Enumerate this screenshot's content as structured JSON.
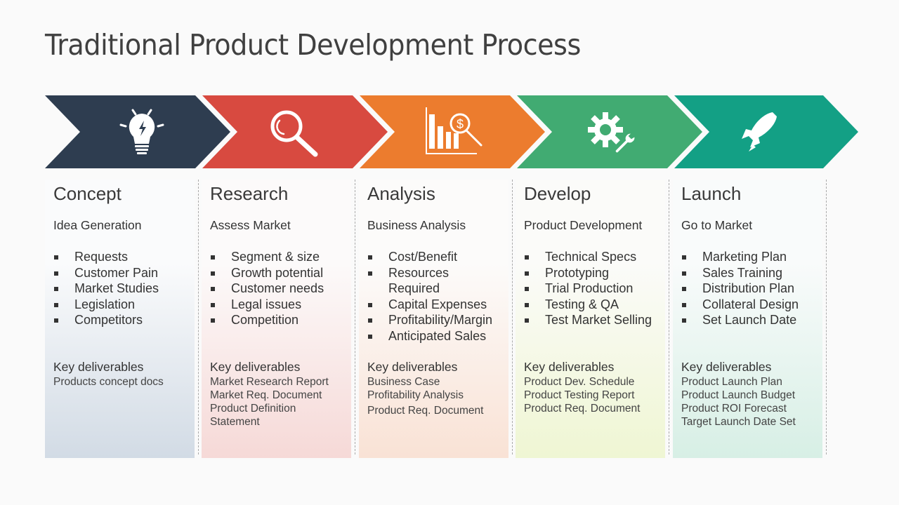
{
  "title": "Traditional Product Development Process",
  "stages": [
    {
      "name": "Concept",
      "icon": "lightbulb-icon",
      "color": "#2e3d50",
      "bg_top": "#fafbfc",
      "bg_bottom": "#d2dbe5",
      "subtitle": "Idea Generation",
      "bullets": [
        "Requests",
        "Customer Pain",
        "Market Studies",
        "Legislation",
        "Competitors"
      ],
      "deliverables_label": "Key deliverables",
      "deliverables": [
        "Products concept docs"
      ]
    },
    {
      "name": "Research",
      "icon": "magnifier-icon",
      "color": "#d84a40",
      "bg_top": "#fcfafa",
      "bg_bottom": "#f6d9d7",
      "subtitle": "Assess Market",
      "bullets": [
        "Segment & size",
        "Growth potential",
        "Customer needs",
        "Legal issues",
        "Competition"
      ],
      "deliverables_label": "Key deliverables",
      "deliverables": [
        "Market Research Report",
        "Market Req. Document",
        "Product Definition",
        "Statement"
      ]
    },
    {
      "name": "Analysis",
      "icon": "financial-analysis-icon",
      "color": "#ec7c2e",
      "bg_top": "#fcfbfa",
      "bg_bottom": "#f9e2d5",
      "subtitle": "Business Analysis",
      "bullets": [
        "Cost/Benefit",
        "Resources Required",
        "Capital Expenses",
        "Profitability/Margin",
        "Anticipated Sales"
      ],
      "deliverables_label": "Key deliverables",
      "deliverables": [
        "Business Case",
        "Profitability Analysis",
        "Product Req. Document"
      ]
    },
    {
      "name": "Develop",
      "icon": "gear-wrench-icon",
      "color": "#41ab72",
      "bg_top": "#fbfbf9",
      "bg_bottom": "#eff6d3",
      "subtitle": "Product Development",
      "bullets": [
        "Technical Specs",
        "Prototyping",
        "Trial Production",
        "Testing & QA",
        "Test Market Selling"
      ],
      "deliverables_label": "Key deliverables",
      "deliverables": [
        "Product Dev. Schedule",
        "Product Testing Report",
        "Product Req. Document"
      ]
    },
    {
      "name": "Launch",
      "icon": "rocket-icon",
      "color": "#13a085",
      "bg_top": "#f9fbfb",
      "bg_bottom": "#d7efe5",
      "subtitle": "Go to Market",
      "bullets": [
        "Marketing Plan",
        "Sales Training",
        "Distribution Plan",
        "Collateral Design",
        "Set Launch Date"
      ],
      "deliverables_label": "Key deliverables",
      "deliverables": [
        "Product Launch Plan",
        "Product Launch Budget",
        "Product ROI Forecast",
        "Target Launch Date Set"
      ]
    }
  ]
}
